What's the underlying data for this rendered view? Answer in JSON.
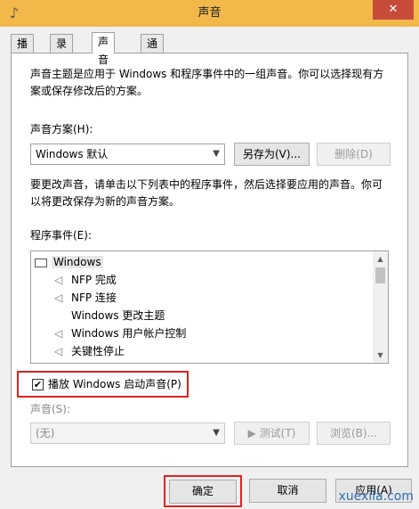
{
  "window": {
    "title": "声音",
    "close_label": "✕"
  },
  "tabs": [
    {
      "label": "播放"
    },
    {
      "label": "录制"
    },
    {
      "label": "声音"
    },
    {
      "label": "通信"
    }
  ],
  "description1_line1": "声音主题是应用于 Windows 和程序事件中的一组声音。你可以选择现有方",
  "description1_line2": "案或保存修改后的方案。",
  "scheme_label": "声音方案(H):",
  "scheme_value": "Windows 默认",
  "save_as_label": "另存为(V)...",
  "delete_label": "删除(D)",
  "description2_line1": "要更改声音，请单击以下列表中的程序事件，然后选择要应用的声音。你可",
  "description2_line2": "以将更改保存为新的声音方案。",
  "events_label": "程序事件(E):",
  "events": {
    "group": "Windows",
    "items": [
      {
        "label": "NFP 完成",
        "has_sound": true
      },
      {
        "label": "NFP 连接",
        "has_sound": true
      },
      {
        "label": "Windows 更改主题",
        "has_sound": false
      },
      {
        "label": "Windows 用户帐户控制",
        "has_sound": true
      },
      {
        "label": "关键性停止",
        "has_sound": true
      }
    ]
  },
  "startup_sound": {
    "label": "播放 Windows 启动声音(P)",
    "checked": true
  },
  "sound_label": "声音(S):",
  "sound_value": "(无)",
  "test_label": "▶ 测试(T)",
  "browse_label": "浏览(B)...",
  "ok_label": "确定",
  "cancel_label": "取消",
  "apply_label": "应用(A)",
  "watermark": "xuexila.com",
  "colors": {
    "titlebar": "#f2b84a",
    "close": "#c74b3b",
    "highlight_frame": "#dd2222"
  }
}
